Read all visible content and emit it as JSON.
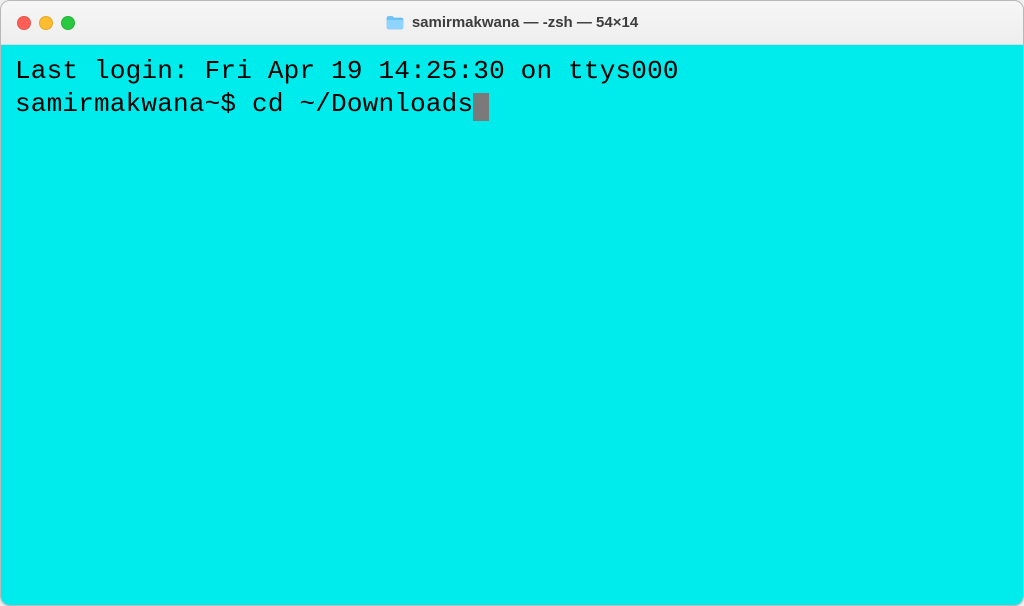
{
  "window": {
    "title": "samirmakwana — -zsh — 54×14"
  },
  "terminal": {
    "last_login_line": "Last login: Fri Apr 19 14:25:30 on ttys000",
    "prompt": "samirmakwana~$ ",
    "command": "cd ~/Downloads"
  },
  "colors": {
    "terminal_bg": "#00ecec",
    "terminal_fg": "#000000",
    "cursor": "#7a7a7a"
  }
}
